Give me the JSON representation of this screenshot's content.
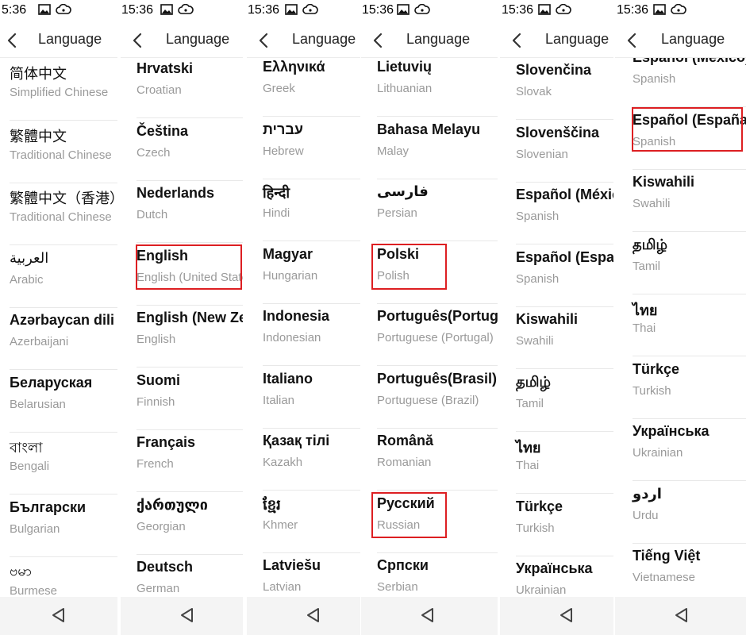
{
  "panels": [
    {
      "status": {
        "time": "5:36"
      },
      "header": {
        "title": "Language"
      },
      "items": [
        {
          "native": "简体中文",
          "english": "Simplified Chinese"
        },
        {
          "native": "繁體中文",
          "english": "Traditional Chinese"
        },
        {
          "native": "繁體中文（香港）",
          "english": "Traditional Chinese"
        },
        {
          "native": "العربية",
          "english": "Arabic"
        },
        {
          "native": "Azərbaycan dili",
          "english": "Azerbaijani"
        },
        {
          "native": "Беларуская",
          "english": "Belarusian"
        },
        {
          "native": "বাংলা",
          "english": "Bengali"
        },
        {
          "native": "Български",
          "english": "Bulgarian"
        },
        {
          "native": "ဗမာ",
          "english": "Burmese"
        }
      ]
    },
    {
      "status": {
        "time": "15:36"
      },
      "header": {
        "title": "Language"
      },
      "items": [
        {
          "native": "Hrvatski",
          "english": "Croatian"
        },
        {
          "native": "Čeština",
          "english": "Czech"
        },
        {
          "native": "Nederlands",
          "english": "Dutch"
        },
        {
          "native": "English",
          "english": "English (United States)"
        },
        {
          "native": "English (New Zealand)",
          "english": "English"
        },
        {
          "native": "Suomi",
          "english": "Finnish"
        },
        {
          "native": "Français",
          "english": "French"
        },
        {
          "native": "ქართული",
          "english": "Georgian"
        },
        {
          "native": "Deutsch",
          "english": "German"
        }
      ]
    },
    {
      "status": {
        "time": "15:36"
      },
      "header": {
        "title": "Language"
      },
      "items": [
        {
          "native": "Ελληνικά",
          "english": "Greek"
        },
        {
          "native": "עברית",
          "english": "Hebrew"
        },
        {
          "native": "हिन्दी",
          "english": "Hindi"
        },
        {
          "native": "Magyar",
          "english": "Hungarian"
        },
        {
          "native": "Indonesia",
          "english": "Indonesian"
        },
        {
          "native": "Italiano",
          "english": "Italian"
        },
        {
          "native": "Қазақ тілі",
          "english": "Kazakh"
        },
        {
          "native": "ខ្មែរ",
          "english": "Khmer"
        },
        {
          "native": "Latviešu",
          "english": "Latvian"
        }
      ]
    },
    {
      "status": {
        "time": "15:36"
      },
      "header": {
        "title": "Language"
      },
      "items": [
        {
          "native": "Lietuvių",
          "english": "Lithuanian"
        },
        {
          "native": "Bahasa Melayu",
          "english": "Malay"
        },
        {
          "native": "فارسی",
          "english": "Persian"
        },
        {
          "native": "Polski",
          "english": "Polish"
        },
        {
          "native": "Português(Portugal)",
          "english": "Portuguese (Portugal)"
        },
        {
          "native": "Português(Brasil)",
          "english": "Portuguese (Brazil)"
        },
        {
          "native": "Română",
          "english": "Romanian"
        },
        {
          "native": "Русский",
          "english": "Russian"
        },
        {
          "native": "Српски",
          "english": "Serbian"
        }
      ]
    },
    {
      "status": {
        "time": "15:36"
      },
      "header": {
        "title": "Language"
      },
      "items": [
        {
          "native": "Slovenčina",
          "english": "Slovak"
        },
        {
          "native": "Slovenščina",
          "english": "Slovenian"
        },
        {
          "native": "Español (México)",
          "english": "Spanish"
        },
        {
          "native": "Español (España)",
          "english": "Spanish"
        },
        {
          "native": "Kiswahili",
          "english": "Swahili"
        },
        {
          "native": "தமிழ்",
          "english": "Tamil"
        },
        {
          "native": "ไทย",
          "english": "Thai"
        },
        {
          "native": "Türkçe",
          "english": "Turkish"
        },
        {
          "native": "Українська",
          "english": "Ukrainian"
        }
      ]
    },
    {
      "status": {
        "time": "15:36"
      },
      "header": {
        "title": "Language"
      },
      "items": [
        {
          "native": "Español (México)",
          "english": "Spanish"
        },
        {
          "native": "Español (España)",
          "english": "Spanish"
        },
        {
          "native": "Kiswahili",
          "english": "Swahili"
        },
        {
          "native": "தமிழ்",
          "english": "Tamil"
        },
        {
          "native": "ไทย",
          "english": "Thai"
        },
        {
          "native": "Türkçe",
          "english": "Turkish"
        },
        {
          "native": "Українська",
          "english": "Ukrainian"
        },
        {
          "native": "اردو",
          "english": "Urdu"
        },
        {
          "native": "Tiếng Việt",
          "english": "Vietnamese"
        }
      ]
    }
  ],
  "highlighted": [
    "English",
    "Polski",
    "Русский",
    "Español (España)"
  ],
  "theme": {
    "highlight_color": "#dd1f22",
    "nav_bar_color": "#f4f4f4"
  },
  "icons": {
    "back": "chevron-left-icon",
    "nav_back": "triangle-back-icon",
    "status": [
      "image-icon",
      "cloud-icon"
    ]
  }
}
